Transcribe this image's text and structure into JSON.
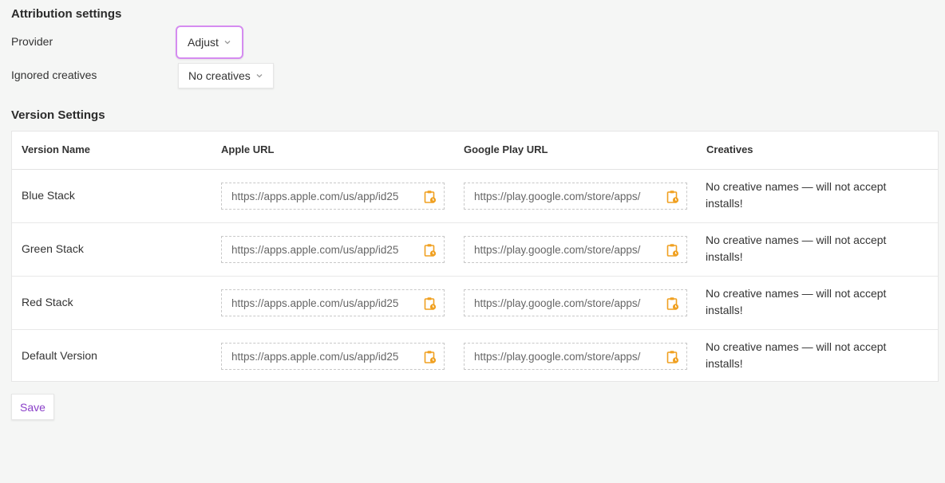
{
  "attribution": {
    "title": "Attribution settings",
    "provider_label": "Provider",
    "provider_value": "Adjust",
    "ignored_label": "Ignored creatives",
    "ignored_value": "No creatives"
  },
  "versions": {
    "title": "Version Settings",
    "headers": {
      "name": "Version Name",
      "apple": "Apple URL",
      "google": "Google Play URL",
      "creatives": "Creatives"
    },
    "rows": [
      {
        "name": "Blue Stack",
        "apple_url": "https://apps.apple.com/us/app/id25",
        "google_url": "https://play.google.com/store/apps/",
        "creatives": "No creative names — will not accept installs!"
      },
      {
        "name": "Green Stack",
        "apple_url": "https://apps.apple.com/us/app/id25",
        "google_url": "https://play.google.com/store/apps/",
        "creatives": "No creative names — will not accept installs!"
      },
      {
        "name": "Red Stack",
        "apple_url": "https://apps.apple.com/us/app/id25",
        "google_url": "https://play.google.com/store/apps/",
        "creatives": "No creative names — will not accept installs!"
      },
      {
        "name": "Default Version",
        "apple_url": "https://apps.apple.com/us/app/id25",
        "google_url": "https://play.google.com/store/apps/",
        "creatives": "No creative names — will not accept installs!"
      }
    ]
  },
  "save_label": "Save",
  "icons": {
    "dropdown": "chevron-down-icon",
    "copy": "clipboard-icon"
  },
  "colors": {
    "accent": "#8a3fc8",
    "focus_ring": "#d58cf0",
    "clipboard": "#f0a020"
  }
}
